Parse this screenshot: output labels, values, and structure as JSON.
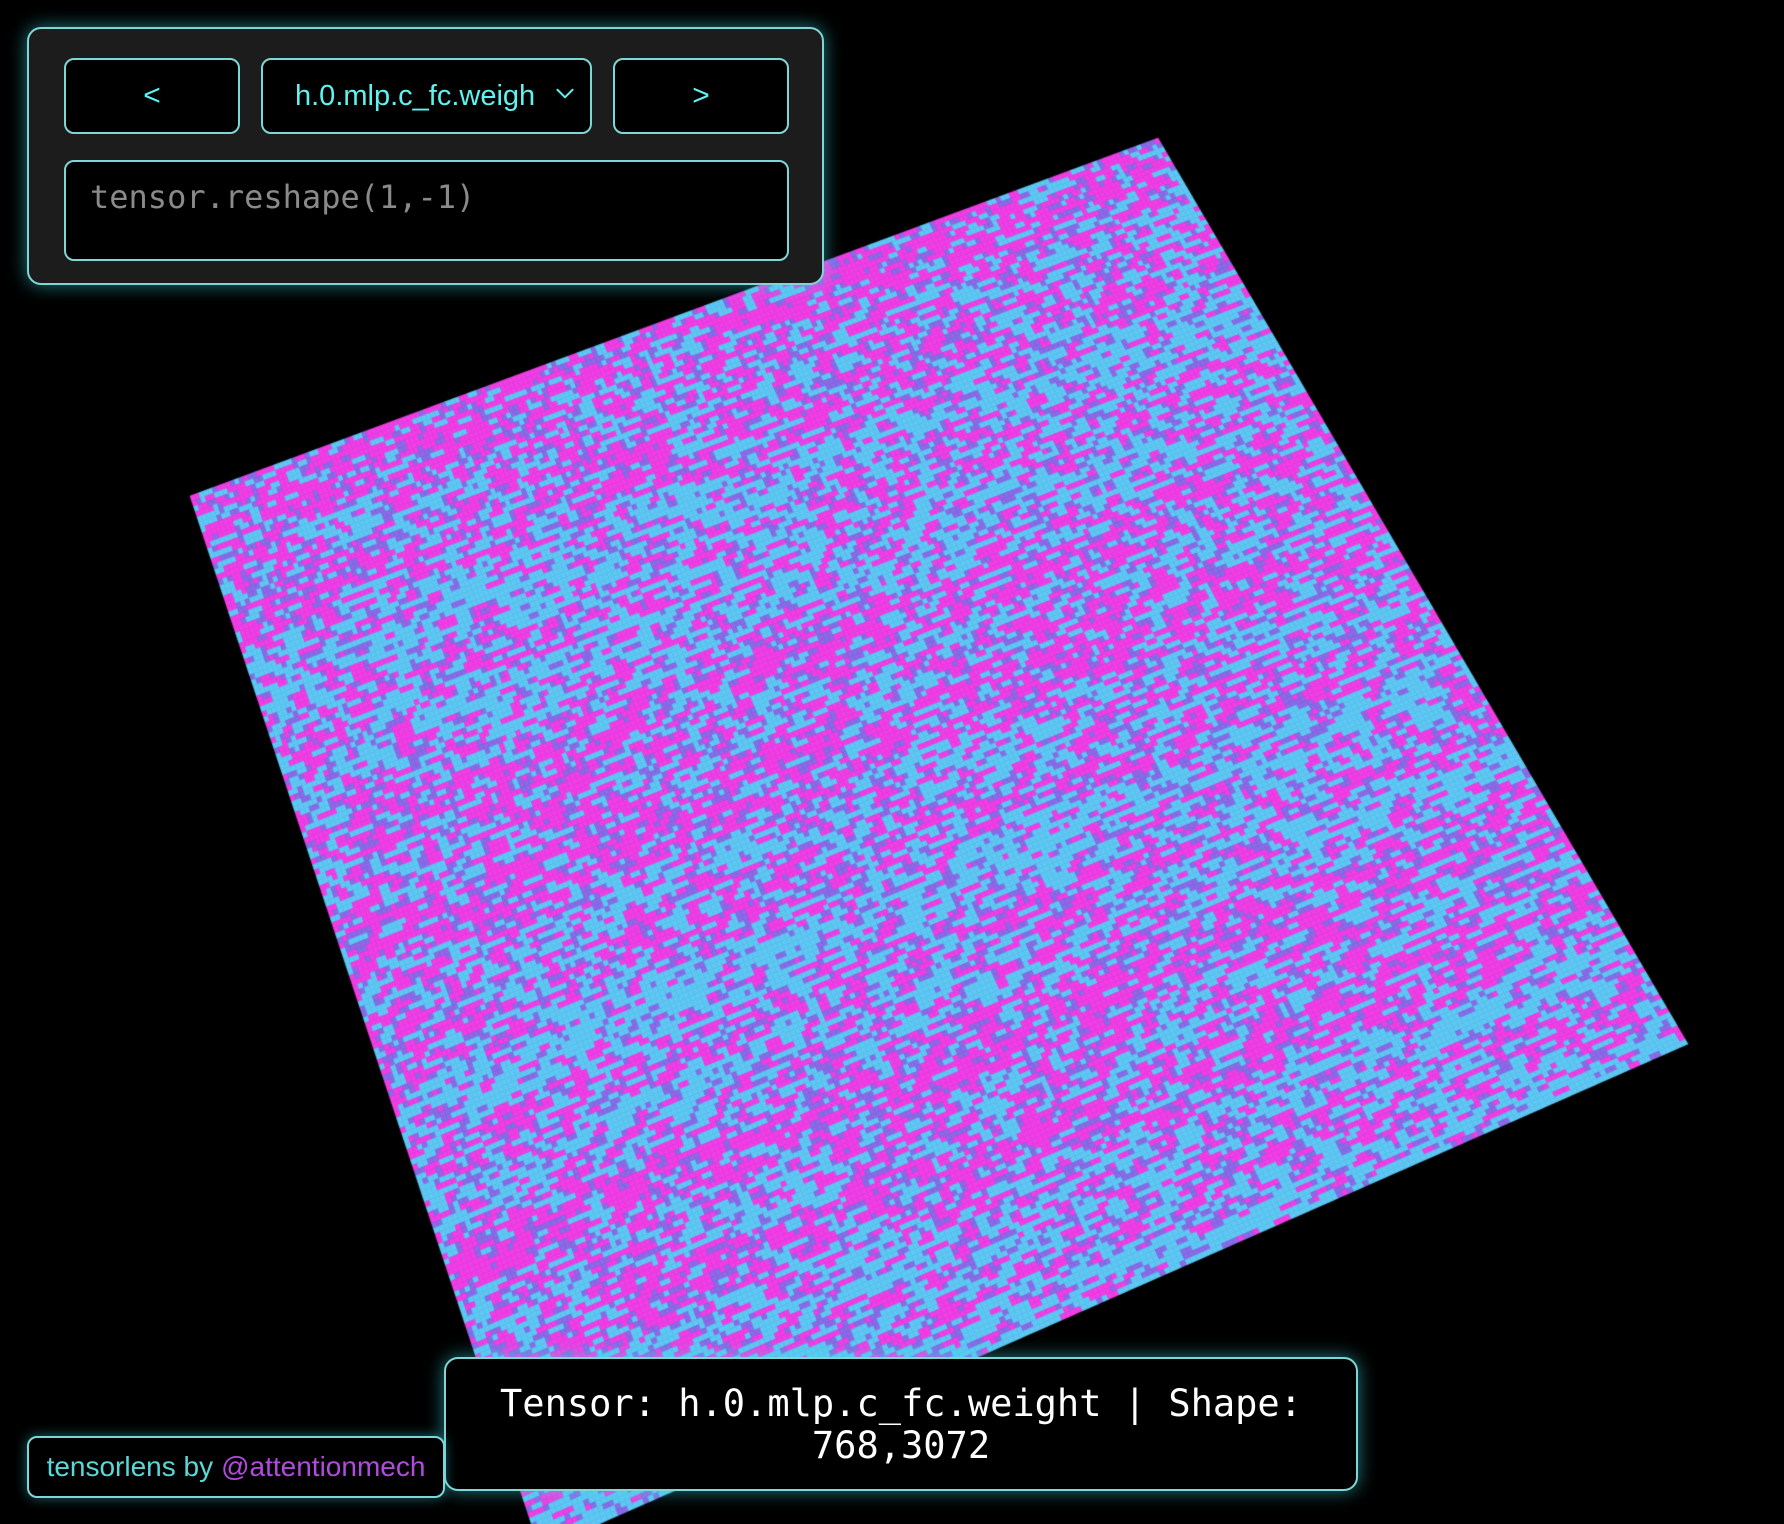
{
  "controls": {
    "prev_label": "<",
    "next_label": ">",
    "tensor_select": {
      "selected": "h.0.mlp.c_fc.weight"
    },
    "expression": {
      "placeholder": "tensor.reshape(1,-1)"
    }
  },
  "status": {
    "prefix": "Tensor: ",
    "tensor_name": "h.0.mlp.c_fc.weight",
    "separator": " | ",
    "shape_label": "Shape: ",
    "shape_value": "768,3072"
  },
  "footer": {
    "app_name": "tensorlens",
    "by_label": "by",
    "author_handle": "@attentionmech"
  },
  "visualization": {
    "colormap": {
      "positive": "#f03ee6",
      "negative": "#5ec8f5",
      "mid": "#8a6ae8"
    },
    "background": "#000000",
    "accent": "#7fd6d6"
  }
}
